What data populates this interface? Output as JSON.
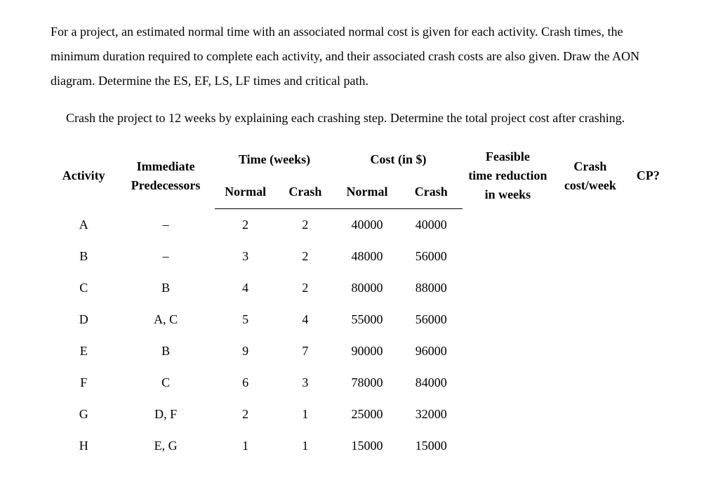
{
  "paragraphs": {
    "p1": "For a project, an estimated normal time with an associated normal cost is given for each activity. Crash times, the minimum duration required to complete each activity, and their associated crash costs are also given. Draw the AON diagram. Determine the ES, EF, LS, LF times and critical path.",
    "p2": "Crash the project to 12 weeks by explaining each crashing step. Determine the total project cost after crashing."
  },
  "headers": {
    "activity": "Activity",
    "predecessors_l1": "Immediate",
    "predecessors_l2": "Predecessors",
    "time_group": "Time (weeks)",
    "time_normal": "Normal",
    "time_crash": "Crash",
    "cost_group": "Cost (in $)",
    "cost_normal": "Normal",
    "cost_crash": "Crash",
    "ftr_l1": "Feasible",
    "ftr_l2": "time reduction",
    "ftr_l3": "in weeks",
    "ccw_l1": "Crash",
    "ccw_l2": "cost/week",
    "cp": "CP?"
  },
  "rows": [
    {
      "activity": "A",
      "pred": "–",
      "tn": "2",
      "tc": "2",
      "cn": "40000",
      "cc": "40000",
      "ftr": "",
      "ccw": "",
      "cp": ""
    },
    {
      "activity": "B",
      "pred": "–",
      "tn": "3",
      "tc": "2",
      "cn": "48000",
      "cc": "56000",
      "ftr": "",
      "ccw": "",
      "cp": ""
    },
    {
      "activity": "C",
      "pred": "B",
      "tn": "4",
      "tc": "2",
      "cn": "80000",
      "cc": "88000",
      "ftr": "",
      "ccw": "",
      "cp": ""
    },
    {
      "activity": "D",
      "pred": "A, C",
      "tn": "5",
      "tc": "4",
      "cn": "55000",
      "cc": "56000",
      "ftr": "",
      "ccw": "",
      "cp": ""
    },
    {
      "activity": "E",
      "pred": "B",
      "tn": "9",
      "tc": "7",
      "cn": "90000",
      "cc": "96000",
      "ftr": "",
      "ccw": "",
      "cp": ""
    },
    {
      "activity": "F",
      "pred": "C",
      "tn": "6",
      "tc": "3",
      "cn": "78000",
      "cc": "84000",
      "ftr": "",
      "ccw": "",
      "cp": ""
    },
    {
      "activity": "G",
      "pred": "D, F",
      "tn": "2",
      "tc": "1",
      "cn": "25000",
      "cc": "32000",
      "ftr": "",
      "ccw": "",
      "cp": ""
    },
    {
      "activity": "H",
      "pred": "E, G",
      "tn": "1",
      "tc": "1",
      "cn": "15000",
      "cc": "15000",
      "ftr": "",
      "ccw": "",
      "cp": ""
    }
  ]
}
